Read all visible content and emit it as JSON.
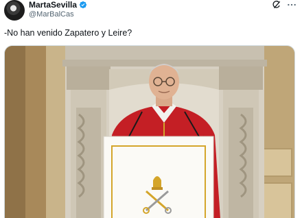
{
  "author": {
    "display_name": "MartaSevilla",
    "handle": "@MarBalCas",
    "verified": true,
    "avatar_icon": "avatar"
  },
  "actions": {
    "grok_icon": "grok-icon",
    "more_icon": "more-dots-icon"
  },
  "tweet": {
    "text": "-No han venido Zapatero y Leire?"
  },
  "colors": {
    "verified_blue": "#1d9bf0",
    "text_primary": "#0f1419",
    "text_secondary": "#536471",
    "cassock_red": "#c41f25",
    "gold": "#d4a52a"
  }
}
